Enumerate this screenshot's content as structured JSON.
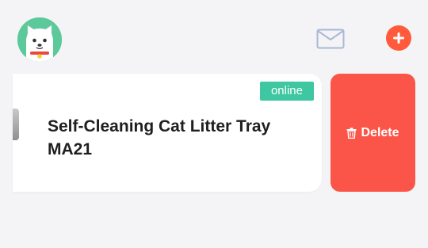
{
  "header": {
    "avatar_icon": "dog-avatar-icon",
    "mail_icon": "envelope-icon",
    "add_icon": "plus-circle-icon",
    "accent_color": "#ff5a3c"
  },
  "device": {
    "status": "online",
    "status_color": "#3ec7a0",
    "name": "Self-Cleaning Cat Litter Tray MA21"
  },
  "actions": {
    "delete_label": "Delete",
    "delete_icon": "trash-icon",
    "delete_color": "#fa5548"
  }
}
